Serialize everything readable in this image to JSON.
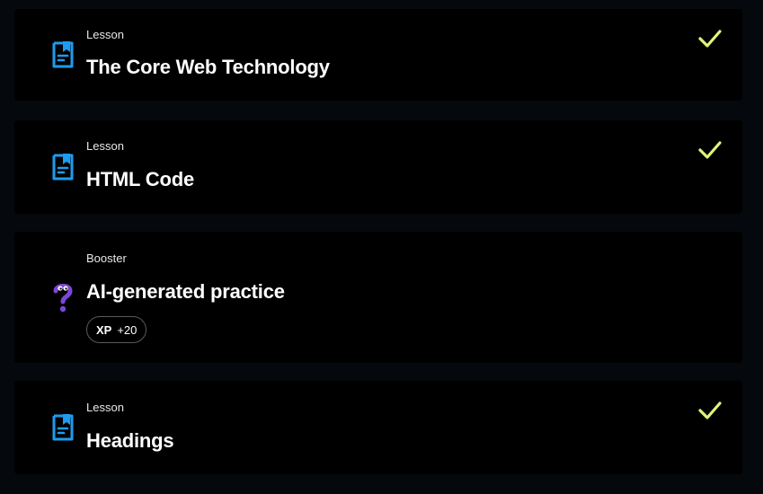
{
  "items": [
    {
      "kind": "Lesson",
      "title": "The Core Web Technology",
      "icon": "lesson-document-icon",
      "completed": true
    },
    {
      "kind": "Lesson",
      "title": "HTML Code",
      "icon": "lesson-document-icon",
      "completed": true
    },
    {
      "kind": "Booster",
      "title": "AI-generated practice",
      "icon": "question-mark-mascot-icon",
      "completed": false,
      "xp": {
        "label": "XP",
        "value": "+20"
      }
    },
    {
      "kind": "Lesson",
      "title": "Headings",
      "icon": "lesson-document-icon",
      "completed": true
    }
  ],
  "colors": {
    "lesson_icon": "#1e9bef",
    "check": "#dff57a",
    "booster_icon": "#7b47d6",
    "card_bg": "#000000",
    "page_bg": "#05080c"
  }
}
